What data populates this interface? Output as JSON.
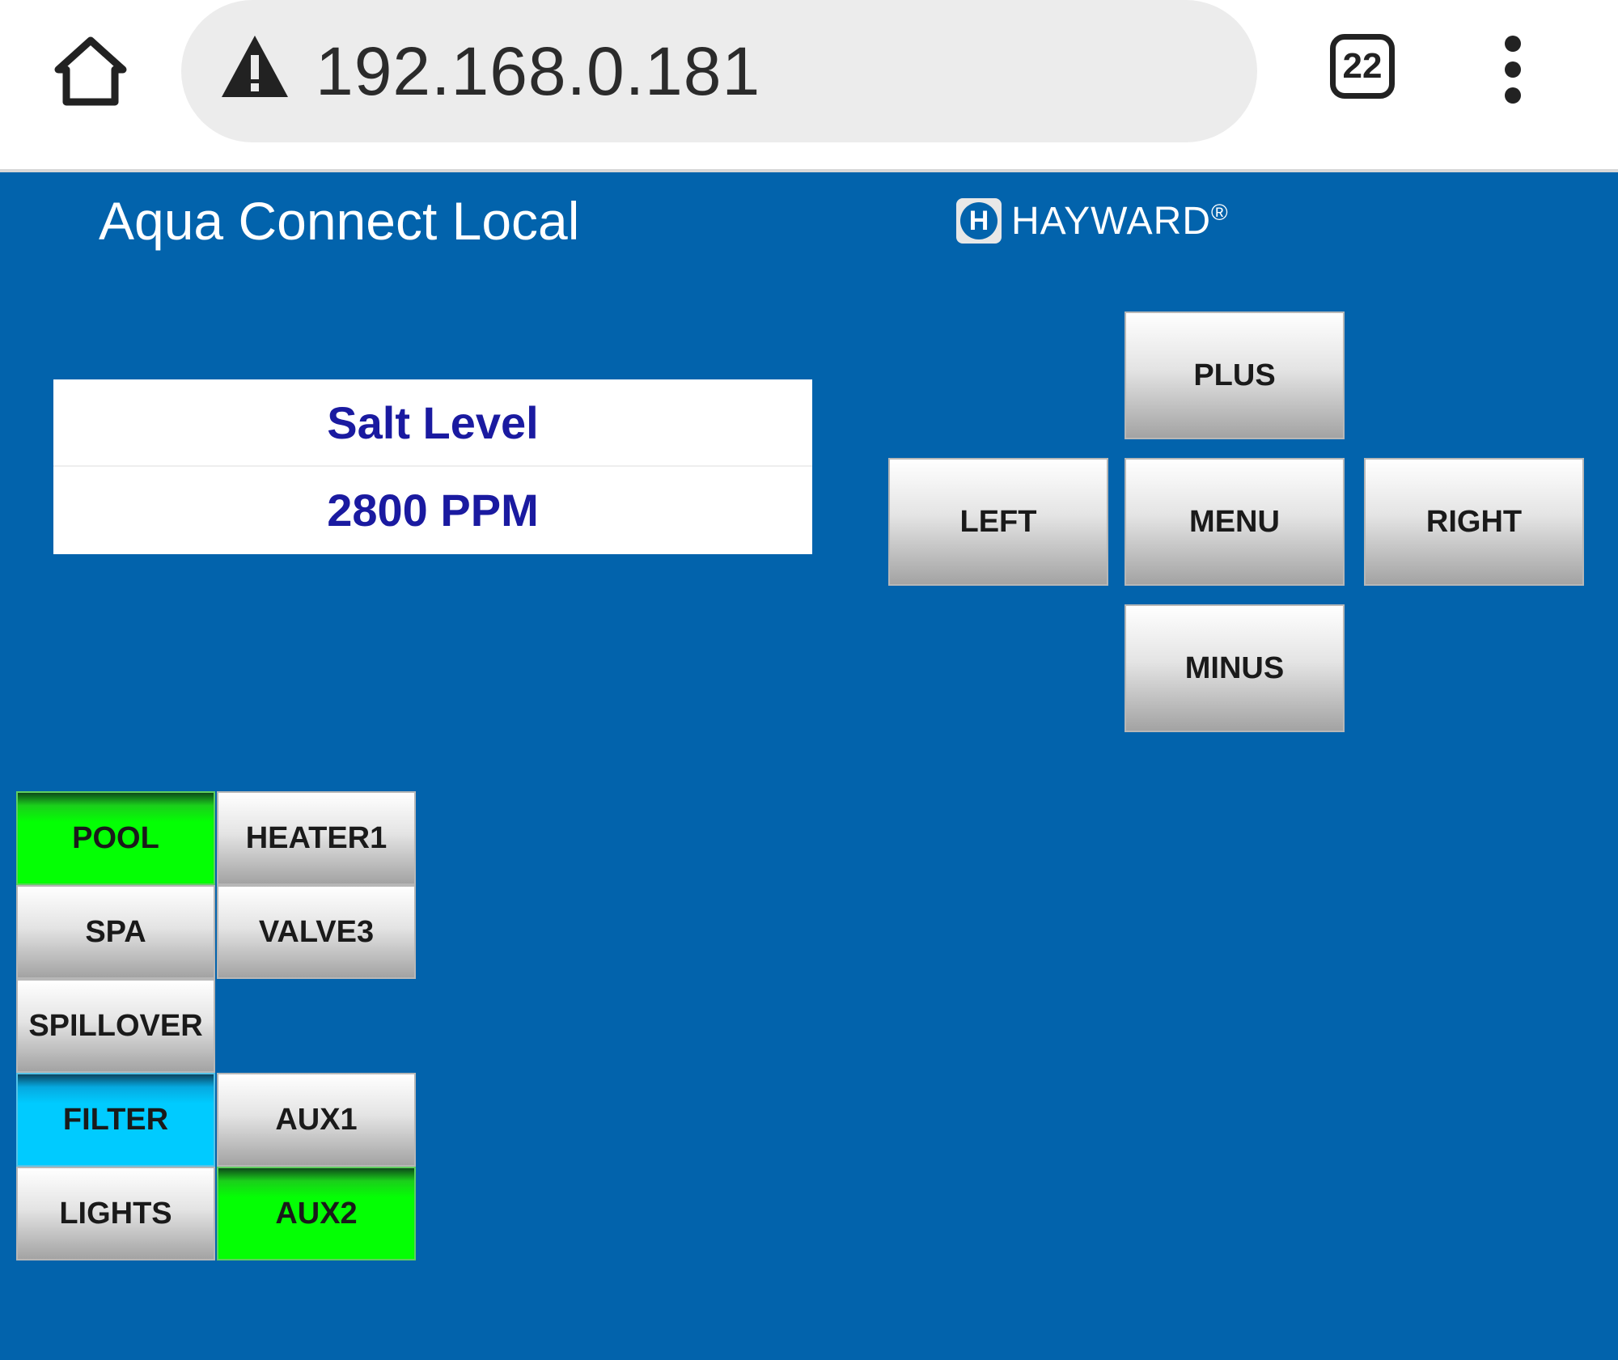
{
  "browser": {
    "url": "192.168.0.181",
    "tab_count": "22",
    "home_icon": "home-icon",
    "warning_icon": "warning-triangle-icon",
    "menu_icon": "kebab-menu-icon"
  },
  "header": {
    "title": "Aqua Connect Local",
    "brand_logo_letter": "H",
    "brand_name": "HAYWARD",
    "brand_mark": "®"
  },
  "display": {
    "line1": "Salt Level",
    "line2": "2800 PPM"
  },
  "nav": {
    "plus": "PLUS",
    "left": "LEFT",
    "menu": "MENU",
    "right": "RIGHT",
    "minus": "MINUS"
  },
  "modes": {
    "pool": "POOL",
    "heater1": "HEATER1",
    "spa": "SPA",
    "valve3": "VALVE3",
    "spillover": "SPILLOVER",
    "filter": "FILTER",
    "aux1": "AUX1",
    "lights": "LIGHTS",
    "aux2": "AUX2"
  },
  "colors": {
    "background": "#0263ac",
    "active_green": "#04ff04",
    "active_cyan": "#00cbff",
    "display_text": "#1a1aa0"
  }
}
